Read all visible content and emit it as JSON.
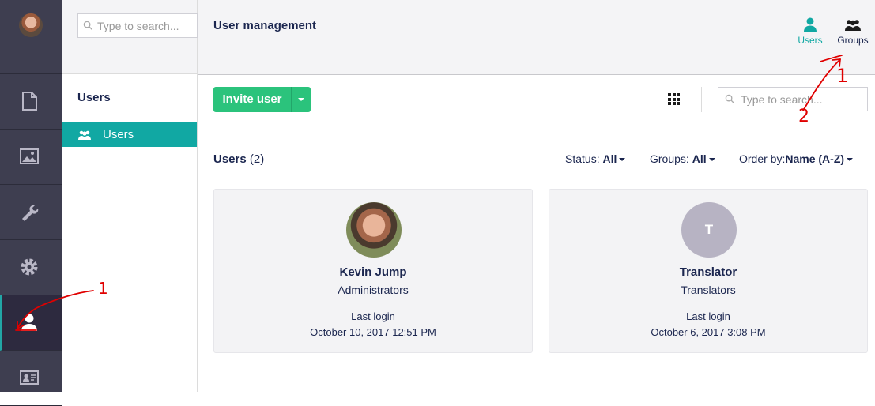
{
  "rail": {
    "items": [
      {
        "name": "content",
        "icon": "document-icon"
      },
      {
        "name": "media",
        "icon": "image-icon"
      },
      {
        "name": "settings",
        "icon": "wrench-icon"
      },
      {
        "name": "developer",
        "icon": "gear-icon"
      },
      {
        "name": "users",
        "icon": "user-icon",
        "active": true
      },
      {
        "name": "members",
        "icon": "id-card-icon"
      }
    ]
  },
  "tree": {
    "search_placeholder": "Type to search...",
    "section_title": "Users",
    "items": [
      {
        "label": "Users",
        "active": true
      }
    ]
  },
  "header": {
    "title": "User management",
    "tabs": [
      {
        "label": "Users",
        "active": true
      },
      {
        "label": "Groups",
        "active": false
      }
    ]
  },
  "toolbar": {
    "invite_label": "Invite user",
    "search_placeholder": "Type to search..."
  },
  "list": {
    "title": "Users",
    "count": "(2)",
    "filters": {
      "status_label": "Status:",
      "status_value": "All",
      "groups_label": "Groups:",
      "groups_value": "All",
      "order_label": "Order by:",
      "order_value": "Name (A-Z)"
    },
    "users": [
      {
        "name": "Kevin Jump",
        "group": "Administrators",
        "login_label": "Last login",
        "login_date": "October 10, 2017 12:51 PM"
      },
      {
        "name": "Translator",
        "initial": "T",
        "group": "Translators",
        "login_label": "Last login",
        "login_date": "October 6, 2017 3:08 PM"
      }
    ]
  },
  "annotations": [
    "1",
    "1",
    "2"
  ],
  "colors": {
    "accent": "#11a8a3",
    "invite": "#2bc37c",
    "rail": "#3e3e50",
    "annotation": "#e00000"
  }
}
